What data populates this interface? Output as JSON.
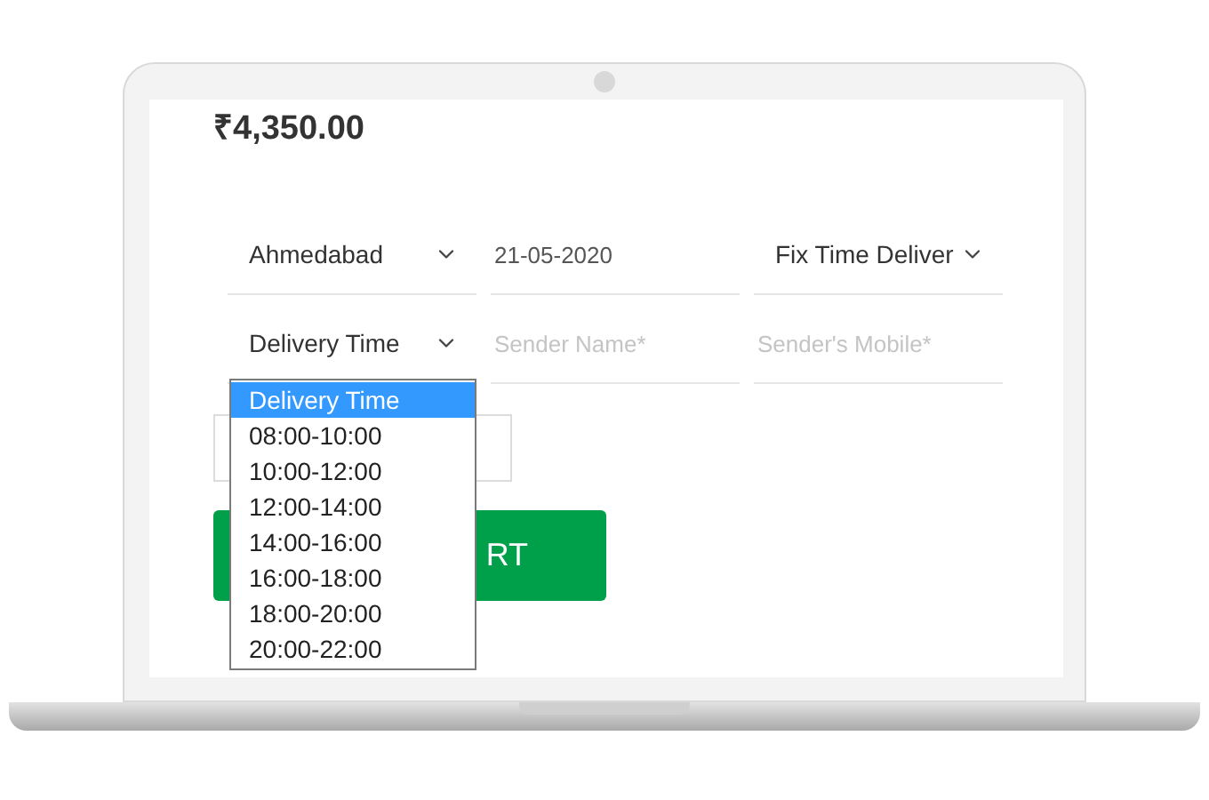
{
  "price": "₹4,350.00",
  "row_1": [
    {
      "kind": "select",
      "value": "Ahmedabad"
    },
    {
      "kind": "input",
      "value": "21-05-2020"
    },
    {
      "kind": "select",
      "value": "Fix Time Deliver"
    }
  ],
  "row_2": [
    {
      "kind": "select",
      "value": "Delivery Time"
    },
    {
      "kind": "input",
      "placeholder": "Sender Name*"
    },
    {
      "kind": "input",
      "placeholder": "Sender's Mobile*"
    }
  ],
  "cart_button": "RT",
  "dropdown": [
    {
      "label": "Delivery Time",
      "selected": true
    },
    {
      "label": "08:00-10:00",
      "selected": false
    },
    {
      "label": "10:00-12:00",
      "selected": false
    },
    {
      "label": "12:00-14:00",
      "selected": false
    },
    {
      "label": "14:00-16:00",
      "selected": false
    },
    {
      "label": "16:00-18:00",
      "selected": false
    },
    {
      "label": "18:00-20:00",
      "selected": false
    },
    {
      "label": "20:00-22:00",
      "selected": false
    }
  ]
}
